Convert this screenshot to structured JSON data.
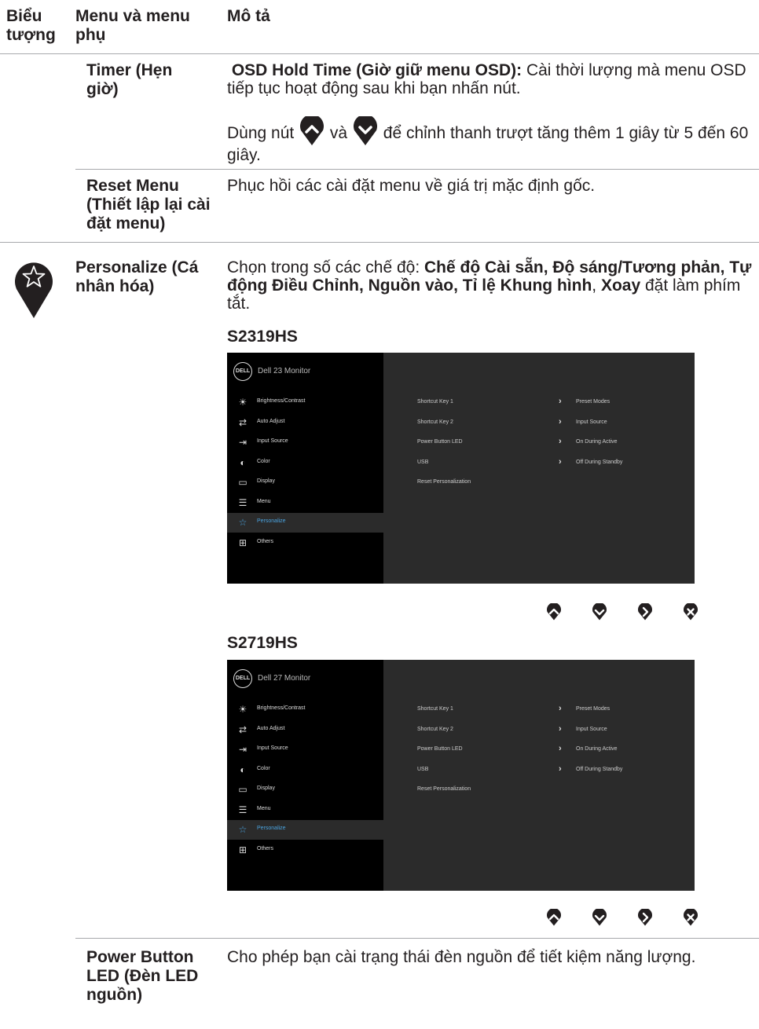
{
  "header": {
    "col1": "Biểu tượng",
    "col2": "Menu và menu phụ",
    "col3": "Mô tả"
  },
  "timer": {
    "menu": "Timer (Hẹn giờ)",
    "desc1_bold": "OSD Hold Time (Giờ giữ menu OSD):",
    "desc1_rest": " Cài thời lượng mà menu OSD tiếp tục hoạt động sau khi bạn nhấn nút.",
    "desc2_a": "Dùng nút ",
    "desc2_b": " và ",
    "desc2_c": " để chỉnh thanh trượt tăng thêm 1 giây từ 5 đến 60 giây."
  },
  "reset_menu": {
    "menu": "Reset Menu (Thiết lập lại cài đặt menu)",
    "desc": "Phục hồi các cài đặt menu về giá trị mặc định gốc."
  },
  "personalize": {
    "icon": "star-icon",
    "menu": "Personalize (Cá nhân hóa)",
    "desc_intro": "Chọn trong số các chế độ: ",
    "desc_bold1": "Chế độ Cài sẵn, Độ sáng/Tương phản, Tự động Điều Chỉnh, Nguồn vào, Tỉ lệ Khung hình",
    "desc_sep": ", ",
    "desc_bold2": "Xoay",
    "desc_end": " đặt làm phím tắt."
  },
  "osd_menu_items": [
    "Brightness/Contrast",
    "Auto Adjust",
    "Input Source",
    "Color",
    "Display",
    "Menu",
    "Personalize",
    "Others"
  ],
  "osd_rows": [
    {
      "key": "Shortcut Key 1",
      "value": "Preset Modes"
    },
    {
      "key": "Shortcut Key 2",
      "value": "Input Source"
    },
    {
      "key": "Power Button LED",
      "value": "On During Active"
    },
    {
      "key": "USB",
      "value": "Off During Standby"
    },
    {
      "key": "Reset Personalization",
      "value": ""
    }
  ],
  "models": [
    {
      "name": "S2319HS",
      "osd_title": "Dell 23 Monitor"
    },
    {
      "name": "S2719HS",
      "osd_title": "Dell 27 Monitor"
    }
  ],
  "osd_logo": "DELL",
  "power_led": {
    "menu": "Power Button LED (Đèn LED nguồn)",
    "desc": "Cho phép bạn cài trạng thái đèn nguồn để tiết kiệm năng lượng."
  },
  "colors": {
    "accent": "#4aa3df",
    "osd_bg": "#2b2b2b",
    "osd_left": "#000000",
    "rule": "#a7a9ac"
  }
}
